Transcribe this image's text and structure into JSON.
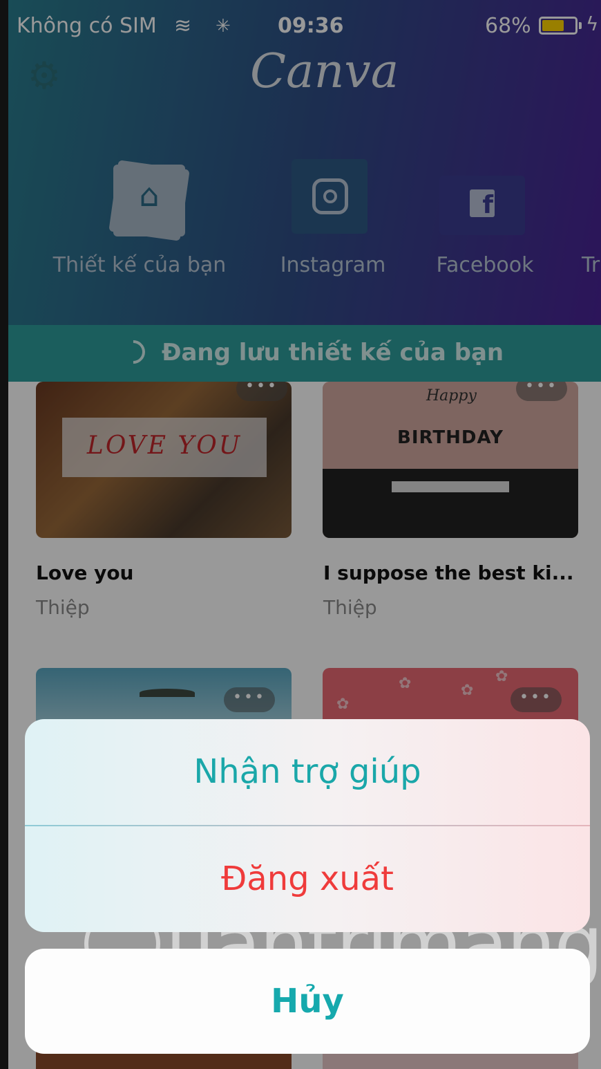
{
  "status_bar": {
    "carrier": "Không có SIM",
    "time": "09:36",
    "battery": "68%",
    "battery_level": 0.68
  },
  "header": {
    "logo": "Canva",
    "accent_colors": [
      "#2a7f8f",
      "#2f4e86",
      "#4a2396"
    ],
    "categories": [
      {
        "label": "Thiết kế của bạn",
        "icon": "home-icon"
      },
      {
        "label": "Instagram",
        "icon": "instagram-icon"
      },
      {
        "label": "Facebook",
        "icon": "facebook-icon"
      },
      {
        "label": "Tr",
        "icon": ""
      }
    ]
  },
  "saving_banner": {
    "text": "Đang lưu thiết kế của bạn",
    "color": "#2e9d9c"
  },
  "designs": [
    {
      "title": "Love you",
      "type": "Thiệp",
      "preview_text": "LOVE YOU"
    },
    {
      "title": "I suppose the best ki...",
      "type": "Thiệp",
      "preview_text": "BIRTHDAY",
      "preview_script": "Happy"
    }
  ],
  "action_sheet": {
    "help_label": "Nhận trợ giúp",
    "logout_label": "Đăng xuất",
    "cancel_label": "Hủy",
    "help_color": "#1aa7a9",
    "logout_color": "#ef3b3b"
  },
  "watermark": {
    "text": "uantrimang"
  }
}
